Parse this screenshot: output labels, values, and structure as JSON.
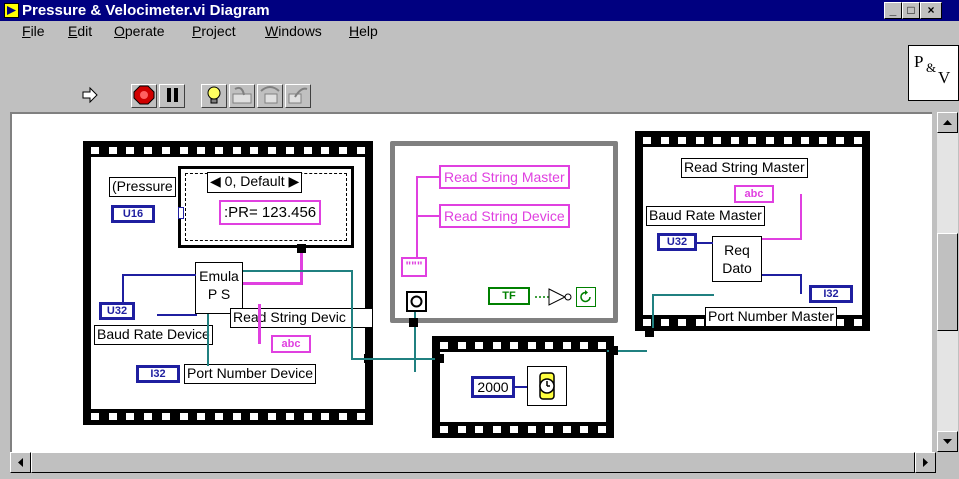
{
  "window": {
    "title": "Pressure & Velocimeter.vi Diagram",
    "controls": [
      "_",
      "□",
      "×"
    ]
  },
  "menu": [
    {
      "label": "File",
      "key": "F",
      "rest": "ile"
    },
    {
      "label": "Edit",
      "key": "E",
      "rest": "dit"
    },
    {
      "label": "Operate",
      "key": "O",
      "rest": "perate"
    },
    {
      "label": "Project",
      "key": "P",
      "rest": "roject"
    },
    {
      "label": "Windows",
      "key": "W",
      "rest": "indows"
    },
    {
      "label": "Help",
      "key": "H",
      "rest": "elp"
    }
  ],
  "toolbar": {
    "arrow_icon": "run-arrow-icon",
    "buttons": [
      "abort-icon",
      "pause-icon",
      "highlight-execution-icon",
      "step-into-icon",
      "step-over-icon",
      "step-out-icon"
    ]
  },
  "vi_icon": {
    "text": "P&V",
    "p": "P",
    "amp": "&",
    "v": "V"
  },
  "diagram": {
    "left_frame": {
      "pressure_label": "(Pressure",
      "u16": "U16",
      "case_selector": "0, Default",
      "case_left_arrow": "◀",
      "case_right_arrow": "▶",
      "format_string": ":PR= 123.456",
      "emula_line1": "Emula",
      "emula_line2": "P S",
      "u32": "U32",
      "baud_rate_device": "Baud Rate Device",
      "read_string_device": "Read String Devic",
      "abc": "abc",
      "i32": "I32",
      "port_number_device": "Port Number Device"
    },
    "middle_loop": {
      "read_string_master": "Read String Master",
      "read_string_device": "Read String Device",
      "tf": "TF",
      "string_const": "\"\"\""
    },
    "wait_frame": {
      "value": "2000"
    },
    "right_frame": {
      "read_string_master": "Read String Master",
      "abc": "abc",
      "baud_rate_master": "Baud Rate Master",
      "u32": "U32",
      "req_line1": "Req",
      "req_line2": "Dato",
      "i32": "I32",
      "port_number_master": "Port Number Master"
    }
  },
  "colors": {
    "titlebar": "#000080",
    "string_wire": "#e040e0",
    "numeric_wire": "#1f1fa0",
    "boolean": "#008000"
  }
}
